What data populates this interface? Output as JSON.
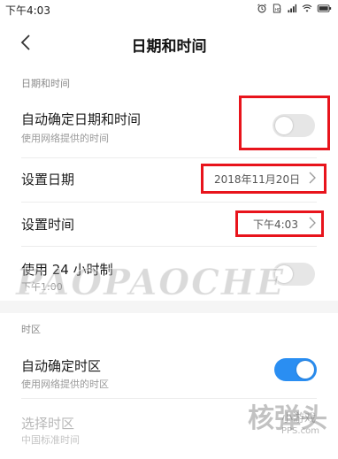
{
  "status_bar": {
    "time": "下午4:03",
    "icons": [
      "alarm-icon",
      "sim-icon",
      "signal-icon",
      "wifi-icon",
      "battery-icon"
    ]
  },
  "header": {
    "title": "日期和时间",
    "back_icon": "chevron-left-icon"
  },
  "sections": {
    "date_time_label": "日期和时间",
    "timezone_label": "时区"
  },
  "rows": {
    "auto_datetime": {
      "title": "自动确定日期和时间",
      "subtitle": "使用网络提供的时间",
      "toggle": "off"
    },
    "set_date": {
      "title": "设置日期",
      "value": "2018年11月20日"
    },
    "set_time": {
      "title": "设置时间",
      "value": "下午4:03"
    },
    "use_24h": {
      "title": "使用 24 小时制",
      "subtitle": "下午1:00",
      "toggle": "off"
    },
    "auto_timezone": {
      "title": "自动确定时区",
      "subtitle": "使用网络提供的时区",
      "toggle": "on"
    },
    "select_timezone": {
      "title": "选择时区",
      "subtitle": "中国标准时间"
    }
  },
  "watermarks": {
    "main": "PAOPAOCHE",
    "logo_big": "核弹头",
    "logo_small": "小游戏",
    "logo_url": "PPS.com"
  },
  "colors": {
    "highlight": "#e8141c",
    "toggle_on": "#2a8ef2",
    "toggle_off": "#e6e6e6",
    "section_label": "#8a8a8a"
  }
}
